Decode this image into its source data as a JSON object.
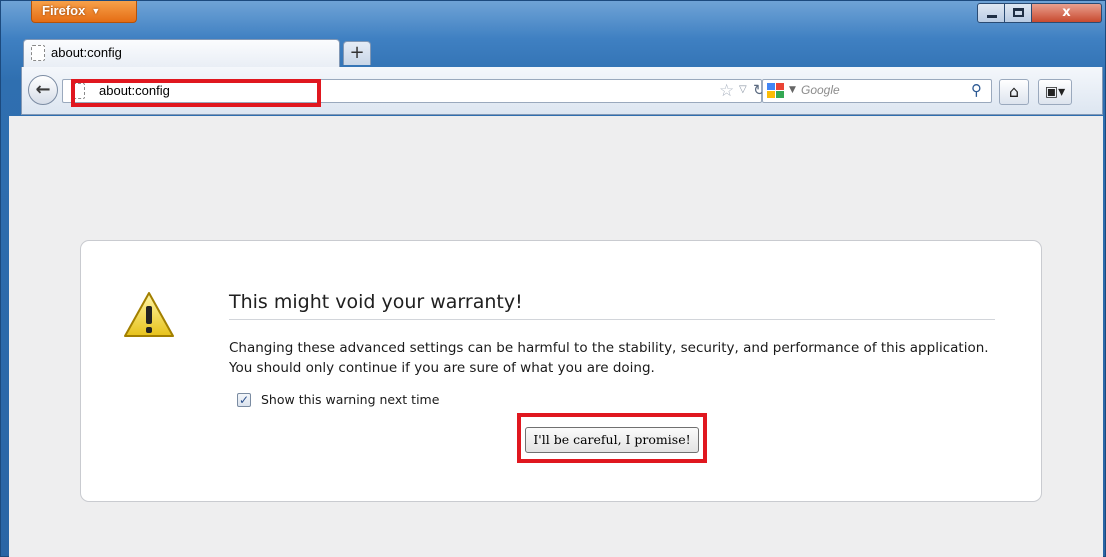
{
  "app": {
    "menu_button_label": "Firefox"
  },
  "window_controls": {
    "close_label": "x"
  },
  "tabs": [
    {
      "label": "about:config"
    }
  ],
  "new_tab_label": "+",
  "navbar": {
    "url": "about:config",
    "search_engine": "Google",
    "search_placeholder": "Google"
  },
  "warning": {
    "title": "This might void your warranty!",
    "description": "Changing these advanced settings can be harmful to the stability, security, and performance of this application. You should only continue if you are sure of what you are doing.",
    "checkbox_label": "Show this warning next time",
    "checkbox_checked": true,
    "confirm_button_label": "I'll be careful, I promise!"
  },
  "colors": {
    "highlight": "#e0171f",
    "firefox_orange": "#e56d14",
    "window_blue": "#3f80c2"
  }
}
